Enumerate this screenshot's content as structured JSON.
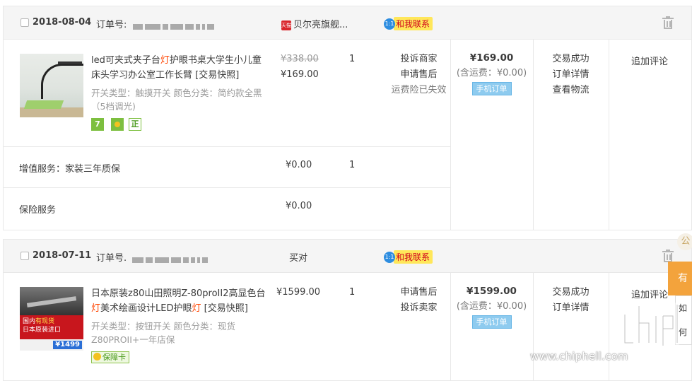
{
  "orders": [
    {
      "date": "2018-08-04",
      "order_no_label": "订单号:",
      "shop_name": "贝尔亮旗舰...",
      "shop_badge": "天猫",
      "contact_label": "和我联系",
      "contact_bubble": "1:1",
      "product": {
        "name_a": "led可夹式夹子台",
        "name_hl": "灯",
        "name_b": "护眼书桌大学生小儿童床头学习办公室工作长臂 [交易快照]",
        "attrs": "开关类型：触摸开关  颜色分类：简约款全黑（5档调光)",
        "original_price": "¥338.00",
        "price": "¥169.00",
        "qty": "1",
        "badges": [
          "7",
          "",
          "正"
        ],
        "actions": [
          "投诉商家",
          "申请售后",
          "运费险已失效"
        ]
      },
      "total": "¥169.00",
      "shipping_note": "(含运费：¥0.00)",
      "mobile_tag": "手机订单",
      "status_links": [
        "交易成功",
        "订单详情",
        "查看物流"
      ],
      "review_label": "追加评论",
      "extras": [
        {
          "label": "增值服务：家装三年质保",
          "price": "¥0.00",
          "qty": "1"
        },
        {
          "label": "保险服务",
          "price": "¥0.00",
          "qty": ""
        }
      ]
    },
    {
      "date": "2018-07-11",
      "order_no_label": "订单号.",
      "shop_name": "买对",
      "contact_label": "和我联系",
      "contact_bubble": "1:1",
      "product": {
        "name_a": "日本原装z80山田照明Z-80proII2高显色台",
        "name_hl": "灯",
        "name_b": "美术绘画设计LED护眼",
        "name_hl2": "灯",
        "name_c": " [交易快照]",
        "attrs": "开关类型：按钮开关  颜色分类：现货Z80PROII+一年店保",
        "price": "¥1599.00",
        "qty": "1",
        "guarantee": "保障卡",
        "img_text_a": "国内",
        "img_text_b": "有现货",
        "img_text_c": "日本原装进口",
        "img_price": "¥1499",
        "actions": [
          "申请售后",
          "投诉卖家"
        ]
      },
      "total": "¥1599.00",
      "shipping_note": "(含运费：¥0.00)",
      "mobile_tag": "手机订单",
      "status_links": [
        "交易成功",
        "订单详情"
      ],
      "review_label": "追加评论"
    }
  ],
  "float_widget": {
    "tab": "有",
    "items": [
      "如何",
      "如何"
    ],
    "corner": "公"
  },
  "watermark": "www.chiphell.com"
}
